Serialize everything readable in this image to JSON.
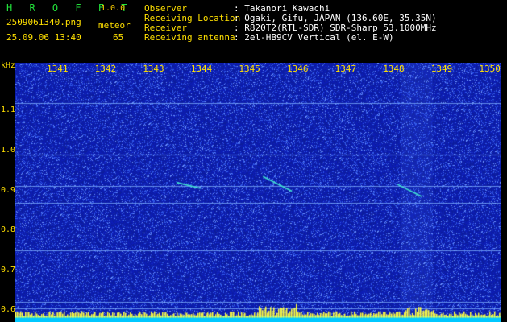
{
  "header": {
    "logo": "H R O F F T",
    "version": "1.0.0",
    "filename": "2509061340.png",
    "date_time": "25.09.06 13:40",
    "count_label": "meteor",
    "count_value": "65",
    "fields": [
      {
        "label": "Observer",
        "value": ": Takanori Kawachi"
      },
      {
        "label": "Receiving Location",
        "value": ": Ogaki, Gifu, JAPAN (136.60E, 35.35N)"
      },
      {
        "label": "Receiver",
        "value": ": R820T2(RTL-SDR) SDR-Sharp 53.1000MHz"
      },
      {
        "label": "Receiving antenna",
        "value": ": 2el-HB9CV Vertical (el. E-W)"
      }
    ]
  },
  "axes": {
    "y_unit": "kHz",
    "x_ticks": [
      "1341",
      "1342",
      "1343",
      "1344",
      "1345",
      "1346",
      "1347",
      "1348",
      "1349",
      "1350"
    ],
    "y_ticks": [
      "1.1",
      "1.0",
      "0.9",
      "0.8",
      "0.7",
      "0.6"
    ],
    "y_range": [
      0.57,
      1.22
    ]
  },
  "spectrogram": {
    "background_color": "#0b1ba8",
    "noise_color": "#4a6cff",
    "carrier_color": "#7fb0ff",
    "meteor_color": "#40e0d0",
    "bottom_color": "#00c8ff",
    "burst_color": "#ffff40",
    "carriers_khz": [
      1.12,
      0.99,
      0.912,
      0.868,
      0.75,
      0.62,
      0.605
    ],
    "meteor_echoes": [
      {
        "time_start": "13:43.5",
        "time_end": "13:44.0",
        "freq_start_khz": 0.92,
        "freq_end_khz": 0.905
      },
      {
        "time_start": "13:45.3",
        "time_end": "13:45.9",
        "freq_start_khz": 0.935,
        "freq_end_khz": 0.898
      },
      {
        "time_start": "13:48.1",
        "time_end": "13:48.6",
        "freq_start_khz": 0.915,
        "freq_end_khz": 0.885
      }
    ]
  }
}
